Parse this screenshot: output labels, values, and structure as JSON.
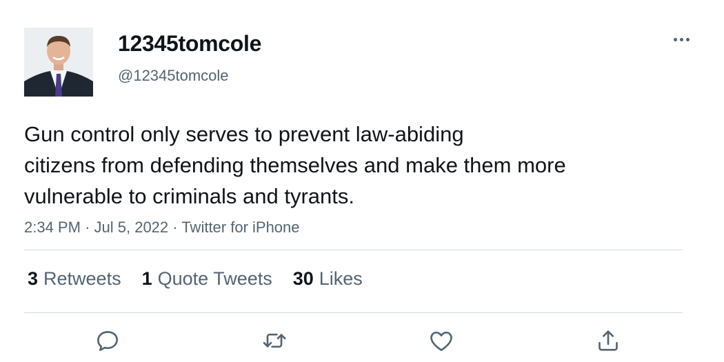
{
  "user": {
    "display_name": "12345tomcole",
    "handle": "@12345tomcole"
  },
  "tweet": {
    "lines": [
      "Gun control only serves to prevent law-abiding",
      "citizens from defending themselves and make them more",
      "vulnerable to criminals and tyrants."
    ],
    "time": "2:34 PM",
    "separator": "·",
    "date": "Jul 5, 2022",
    "source": "Twitter for iPhone"
  },
  "stats": {
    "retweets_count": "3",
    "retweets_label": "Retweets",
    "quotes_count": "1",
    "quotes_label": "Quote Tweets",
    "likes_count": "30",
    "likes_label": "Likes"
  },
  "actions": {
    "reply_icon": "reply-icon",
    "retweet_icon": "retweet-icon",
    "like_icon": "heart-icon",
    "share_icon": "share-icon"
  },
  "colors": {
    "text_primary": "#0f1419",
    "text_secondary": "#536471",
    "divider": "#cfd9de",
    "background": "#ffffff"
  }
}
